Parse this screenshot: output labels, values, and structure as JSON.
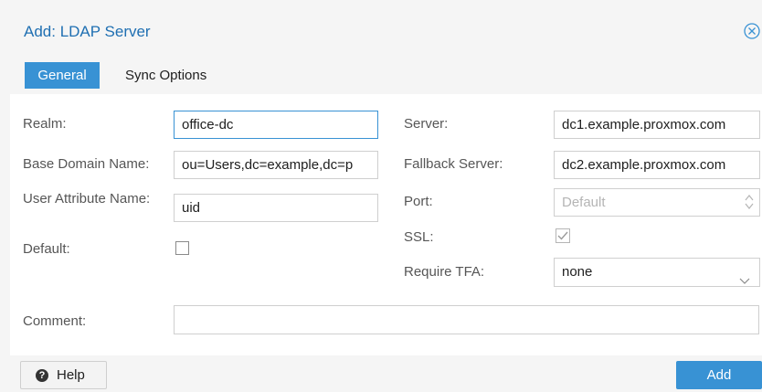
{
  "dialog": {
    "title": "Add: LDAP Server",
    "close_icon": "close-circle-icon",
    "accent_color": "#3892d4"
  },
  "tabs": [
    {
      "label": "General",
      "active": true
    },
    {
      "label": "Sync Options",
      "active": false
    }
  ],
  "form": {
    "realm": {
      "label": "Realm:",
      "value": "office-dc"
    },
    "base_dn": {
      "label": "Base Domain Name:",
      "value": "ou=Users,dc=example,dc=p"
    },
    "user_attr": {
      "label": "User Attribute Name:",
      "value": "uid"
    },
    "default": {
      "label": "Default:",
      "checked": false
    },
    "server": {
      "label": "Server:",
      "value": "dc1.example.proxmox.com"
    },
    "fallback_server": {
      "label": "Fallback Server:",
      "value": "dc2.example.proxmox.com"
    },
    "port": {
      "label": "Port:",
      "placeholder": "Default"
    },
    "ssl": {
      "label": "SSL:",
      "checked": true
    },
    "require_tfa": {
      "label": "Require TFA:",
      "value": "none"
    },
    "comment": {
      "label": "Comment:",
      "value": ""
    }
  },
  "footer": {
    "help_label": "Help",
    "add_label": "Add"
  }
}
